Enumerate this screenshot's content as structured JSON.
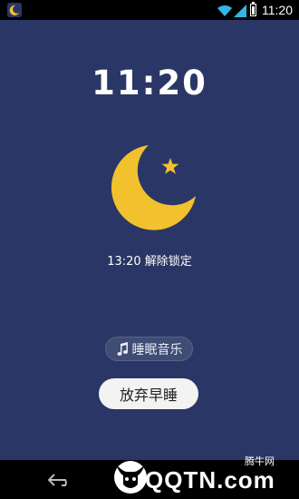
{
  "status_bar": {
    "time": "11:20",
    "battery_level": 0.9
  },
  "clock": {
    "time": "11:20"
  },
  "unlock": {
    "text": "13:20 解除锁定"
  },
  "music_button": {
    "label": "睡眠音乐",
    "icon": "music-note-icon"
  },
  "giveup_button": {
    "label": "放弃早睡"
  },
  "watermark": {
    "brand": "QQTN.com",
    "site": "腾牛网"
  },
  "colors": {
    "background": "#2a3766",
    "moon": "#f2c12e",
    "star": "#f2c12e"
  }
}
